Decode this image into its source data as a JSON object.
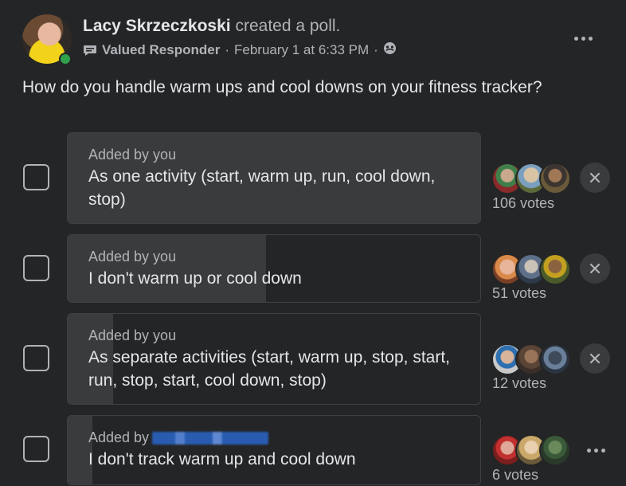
{
  "post": {
    "author": "Lacy Skrzeczkoski",
    "action": "created a poll.",
    "badge_icon": "badge-icon",
    "badge": "Valued Responder",
    "separator": "·",
    "timestamp": "February 1 at 6:33 PM",
    "privacy_icon": "group-icon",
    "question": "How do you handle warm ups and cool downs on your fitness tracker?"
  },
  "poll": {
    "options": [
      {
        "added_by": "Added by you",
        "label": "As one activity (start, warm up, run, cool down, stop)",
        "votes": "106 votes",
        "fill_fraction": 1.0,
        "control": "remove"
      },
      {
        "added_by": "Added by you",
        "label": "I don't warm up or cool down",
        "votes": "51 votes",
        "fill_fraction": 0.48,
        "control": "remove"
      },
      {
        "added_by": "Added by you",
        "label": "As separate activities (start, warm up, stop, start, run, stop, start, cool down, stop)",
        "votes": "12 votes",
        "fill_fraction": 0.11,
        "control": "remove"
      },
      {
        "added_by": "Added by",
        "added_by_blurred": true,
        "label": "I don't track warm up and cool down",
        "votes": "6 votes",
        "fill_fraction": 0.06,
        "control": "more"
      }
    ]
  },
  "colors": {
    "background": "#242526",
    "bar_fill": "#3a3b3c",
    "text_primary": "#e4e6eb",
    "text_secondary": "#b0b3b8",
    "online": "#31a24c"
  }
}
